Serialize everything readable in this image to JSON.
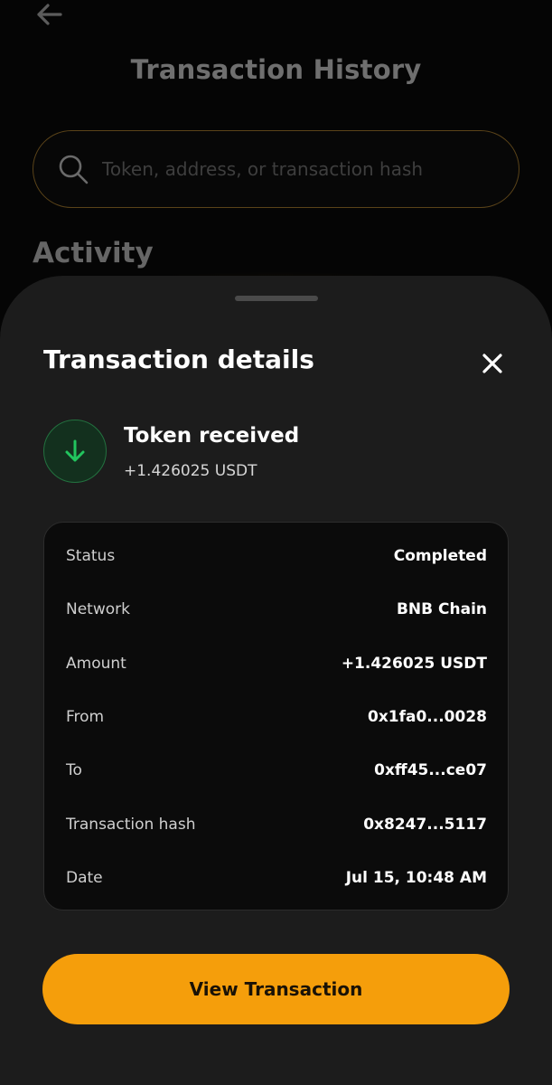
{
  "header": {
    "title": "Transaction History"
  },
  "search": {
    "placeholder": "Token, address, or transaction hash"
  },
  "activity": {
    "heading": "Activity"
  },
  "sheet": {
    "title": "Transaction details",
    "transaction": {
      "type": "Token received",
      "amount": "+1.426025 USDT",
      "icon": "arrow-down-icon",
      "icon_color": "#22c55e"
    },
    "details": [
      {
        "label": "Status",
        "value": "Completed"
      },
      {
        "label": "Network",
        "value": "BNB Chain"
      },
      {
        "label": "Amount",
        "value": "+1.426025 USDT"
      },
      {
        "label": "From",
        "value": "0x1fa0...0028"
      },
      {
        "label": "To",
        "value": "0xff45...ce07"
      },
      {
        "label": "Transaction hash",
        "value": "0x8247...5117"
      },
      {
        "label": "Date",
        "value": "Jul 15, 10:48 AM"
      }
    ],
    "action_label": "View Transaction"
  },
  "colors": {
    "accent": "#f59e0b",
    "success": "#22c55e",
    "sheet_bg": "#1c1c1c"
  }
}
